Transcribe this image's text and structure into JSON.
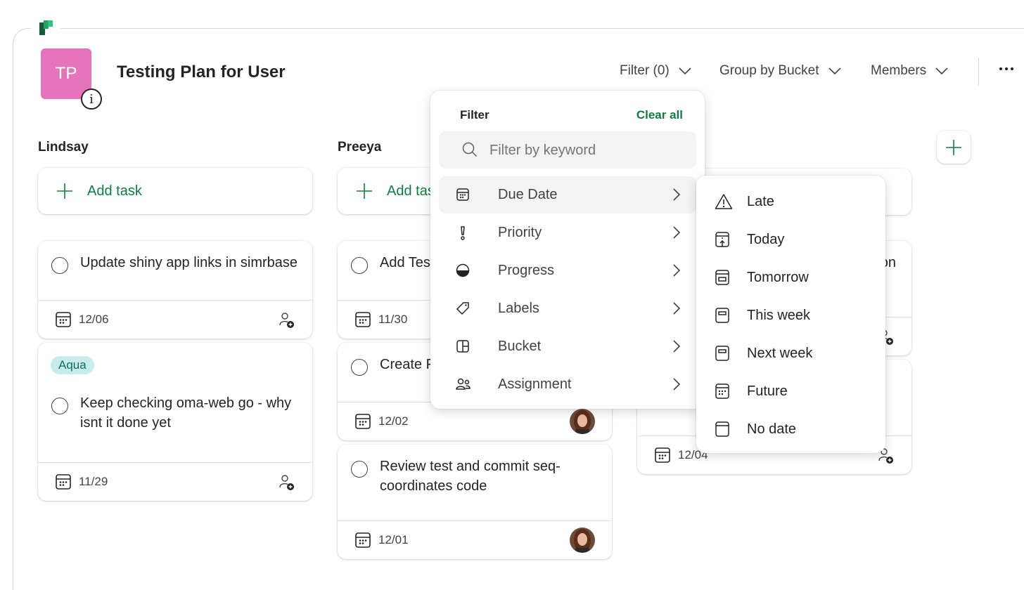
{
  "app": {
    "logo": "planner-logo-icon"
  },
  "plan": {
    "initials": "TP",
    "title": "Testing Plan for User",
    "avatar_color": "#e573bb"
  },
  "toolbar": {
    "filter": "Filter (0)",
    "group": "Group by Bucket",
    "members": "Members"
  },
  "accent": "#107c41",
  "add_task": "Add task",
  "buckets": [
    {
      "name": "Lindsay",
      "add_label": "Add task",
      "tasks": [
        {
          "title": "Update shiny app links in simrbase",
          "date": "12/06",
          "assigned": false
        },
        {
          "label": "Aqua",
          "title": "Keep checking oma-web go - why isnt it done yet",
          "date": "11/29",
          "assigned": false
        }
      ]
    },
    {
      "name": "Preeya",
      "add_label": "Add task",
      "tasks": [
        {
          "title": "Add Tes",
          "date": "11/30",
          "assigned": false
        },
        {
          "title": "Create F",
          "date": "12/02",
          "assigned": true
        },
        {
          "title": "Review test and commit seq-coordinates code",
          "date": "12/01",
          "assigned": true
        }
      ]
    },
    {
      "name": "",
      "add_label": "",
      "tasks": [
        {
          "title": "on",
          "date": "",
          "assigned": true
        },
        {
          "title": "",
          "date": "12/04",
          "assigned": true
        }
      ]
    }
  ],
  "filter": {
    "heading": "Filter",
    "clear": "Clear all",
    "placeholder": "Filter by keyword",
    "items": [
      {
        "label": "Due Date",
        "icon": "calendar-icon"
      },
      {
        "label": "Priority",
        "icon": "priority-icon"
      },
      {
        "label": "Progress",
        "icon": "progress-icon"
      },
      {
        "label": "Labels",
        "icon": "tag-icon"
      },
      {
        "label": "Bucket",
        "icon": "bucket-icon"
      },
      {
        "label": "Assignment",
        "icon": "people-icon"
      }
    ]
  },
  "due_date_menu": [
    {
      "label": "Late",
      "icon": "warning-icon"
    },
    {
      "label": "Today",
      "icon": "calendar-today-icon"
    },
    {
      "label": "Tomorrow",
      "icon": "calendar-tomorrow-icon"
    },
    {
      "label": "This week",
      "icon": "calendar-week-icon"
    },
    {
      "label": "Next week",
      "icon": "calendar-next-week-icon"
    },
    {
      "label": "Future",
      "icon": "calendar-future-icon"
    },
    {
      "label": "No date",
      "icon": "calendar-empty-icon"
    }
  ]
}
